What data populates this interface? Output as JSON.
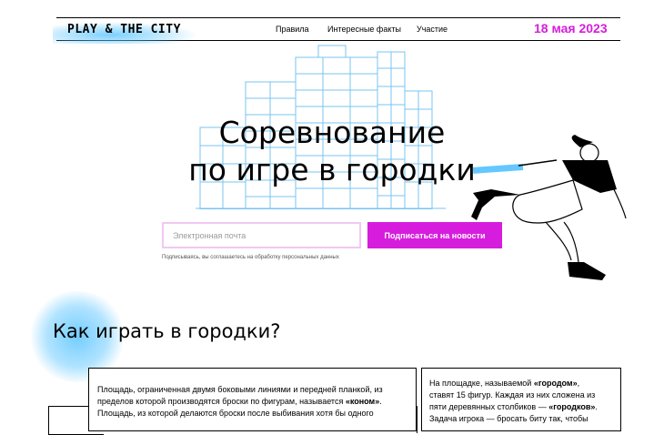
{
  "header": {
    "logo": "PLAY & THE CITY",
    "nav": [
      "Правила",
      "Интересные факты",
      "Участие"
    ],
    "date": "18 мая 2023"
  },
  "hero": {
    "title_line1": "Соревнование",
    "title_line2": "по игре в городки",
    "email_placeholder": "Электронная почта",
    "subscribe_label": "Подписаться на новости",
    "consent": "Подписываясь, вы соглашаетесь на обработку персональных данных"
  },
  "section": {
    "heading": "Как играть в городки?",
    "card1": {
      "line1": "Площадь, ограниченная двумя боковыми линиями и передней планкой, из",
      "line2_pre": "пределов которой производятся броски по фигурам, называется ",
      "line2_bold": "«коном»",
      "line2_post": ".",
      "line3": "Площадь, из которой делаются броски после выбивания хотя бы одного"
    },
    "card2": {
      "line1_pre": "На площадке, называемой ",
      "line1_bold": "«городом»",
      "line1_post": ",",
      "line2": "ставят 15 фигур. Каждая из них сложена из",
      "line3_pre": "пяти деревянных столбиков — ",
      "line3_bold": "«городков»",
      "line3_post": ".",
      "line4": "Задача игрока — бросать биту так, чтобы"
    }
  },
  "colors": {
    "accent": "#d61ddd",
    "spray": "#64c8ff"
  },
  "icons": [
    "building-illustration",
    "player-illustration"
  ]
}
